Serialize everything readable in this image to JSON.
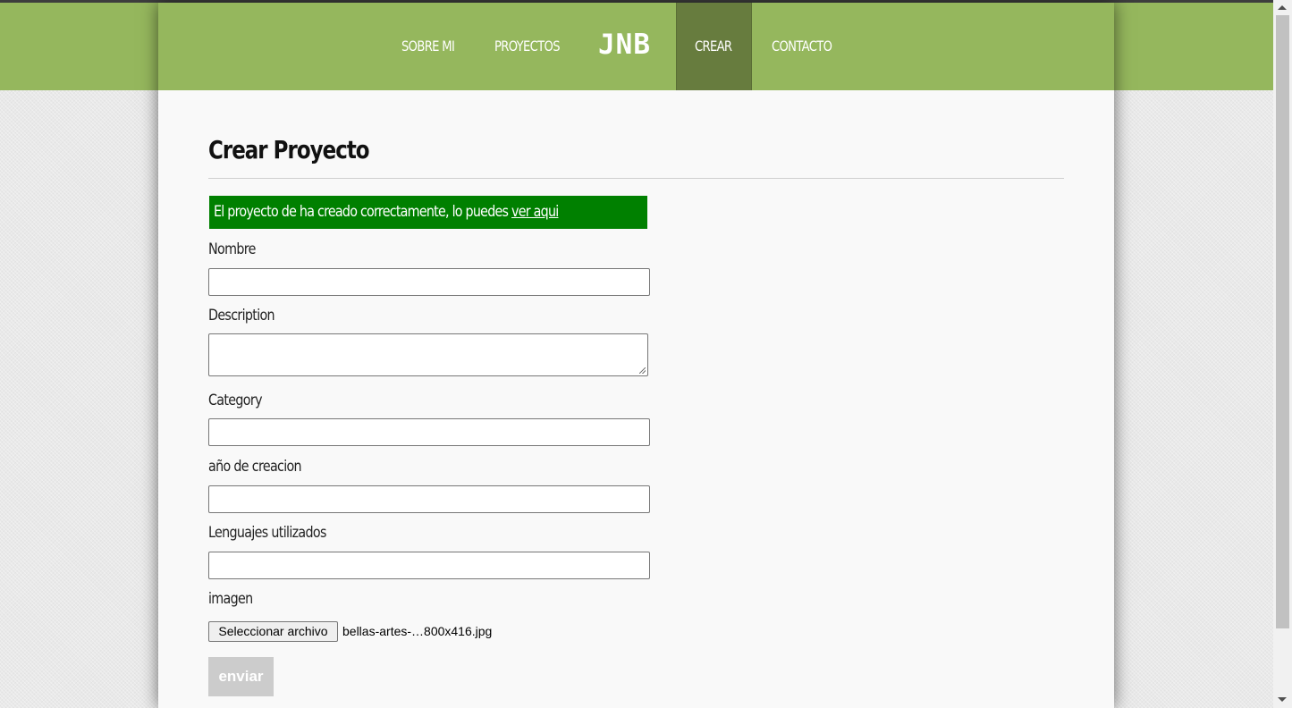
{
  "nav": {
    "items": [
      {
        "label": "SOBRE MI"
      },
      {
        "label": "PROYECTOS"
      },
      {
        "label": "CREAR",
        "active": true
      },
      {
        "label": "CONTACTO"
      }
    ],
    "logo": "JNB"
  },
  "page": {
    "title": "Crear Proyecto",
    "alert": {
      "message": "El proyecto de ha creado correctamente, lo puedes",
      "link_label": "ver aqui",
      "color": "#008000"
    },
    "form": {
      "fields": [
        {
          "label": "Nombre",
          "value": ""
        },
        {
          "label": "Description",
          "value": ""
        },
        {
          "label": "Category",
          "value": ""
        },
        {
          "label": "año de creacion",
          "value": ""
        },
        {
          "label": "Lenguajes utilizados",
          "value": ""
        },
        {
          "label": "imagen"
        }
      ],
      "file_button": "Seleccionar archivo",
      "file_name": "bellas-artes-…800x416.jpg",
      "submit_label": "enviar"
    }
  },
  "colors": {
    "header_green": "#95b75d",
    "active_nav": "#677c3e",
    "submit_disabled": "#cccccc"
  },
  "icons": {
    "scroll_up": "triangle-up",
    "scroll_down": "triangle-down",
    "textarea_grip": "resize-grip"
  }
}
